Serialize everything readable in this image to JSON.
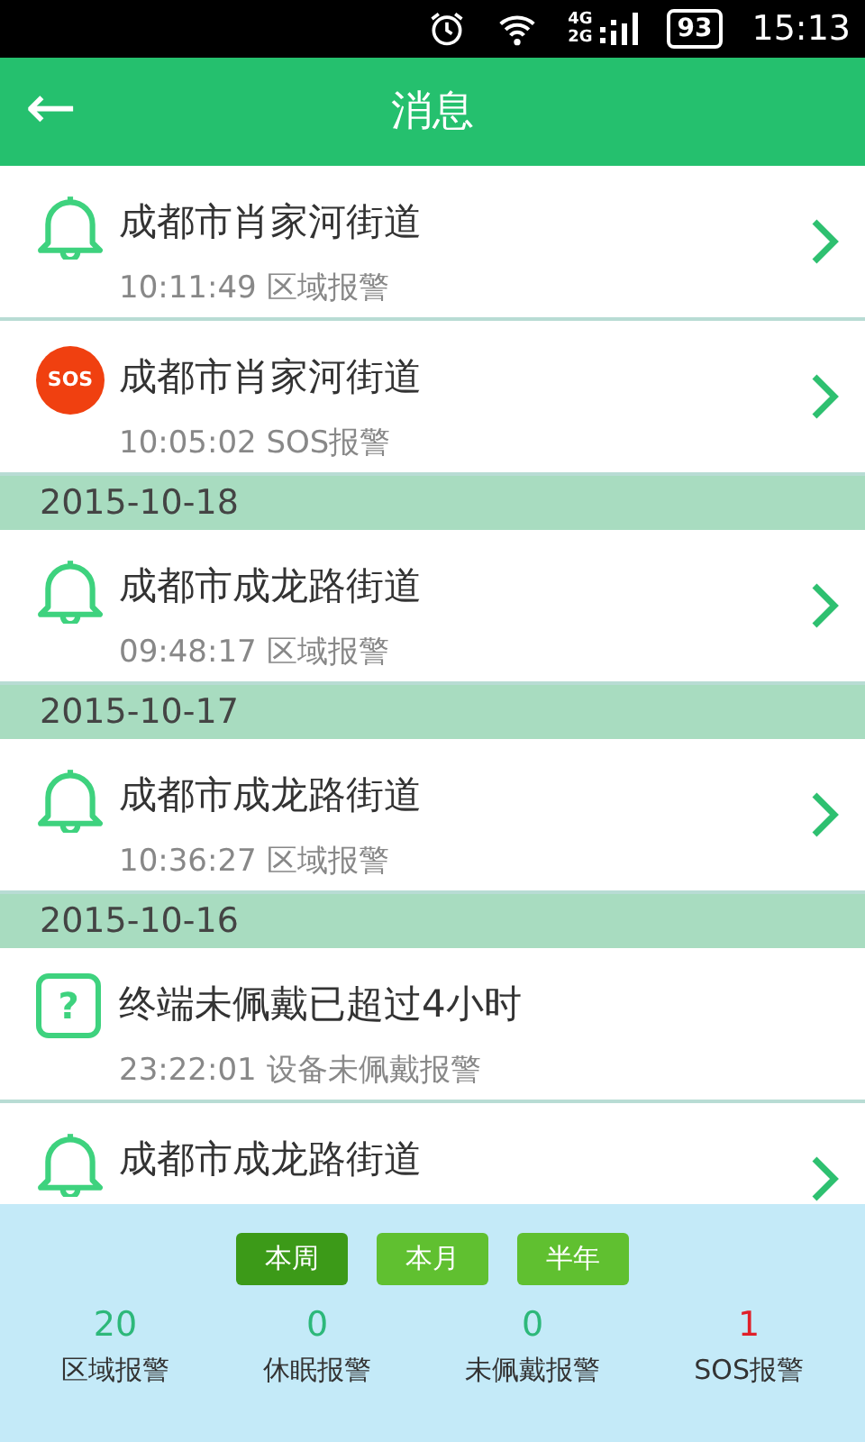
{
  "status_bar": {
    "network_top": "4G",
    "network_bottom": "2G",
    "battery": "93",
    "time": "15:13"
  },
  "header": {
    "back": "←",
    "title": "消息"
  },
  "messages": [
    {
      "kind": "area",
      "title": "成都市肖家河街道",
      "time": "10:11:49",
      "type": "区域报警",
      "has_arrow": true
    },
    {
      "kind": "sos",
      "icon_text": "SOS",
      "title": "成都市肖家河街道",
      "time": "10:05:02",
      "type": "SOS报警",
      "has_arrow": true
    },
    {
      "kind": "date",
      "label": "2015-10-18"
    },
    {
      "kind": "area",
      "title": "成都市成龙路街道",
      "time": "09:48:17",
      "type": "区域报警",
      "has_arrow": true
    },
    {
      "kind": "date",
      "label": "2015-10-17"
    },
    {
      "kind": "area",
      "title": "成都市成龙路街道",
      "time": "10:36:27",
      "type": "区域报警",
      "has_arrow": true
    },
    {
      "kind": "date",
      "label": "2015-10-16"
    },
    {
      "kind": "unworn",
      "icon_text": "?",
      "title": "终端未佩戴已超过4小时",
      "time": "23:22:01",
      "type": "设备未佩戴报警",
      "has_arrow": false
    },
    {
      "kind": "area",
      "title": "成都市成龙路街道",
      "has_arrow": true
    }
  ],
  "periods": [
    {
      "label": "本周",
      "selected": true
    },
    {
      "label": "本月",
      "selected": false
    },
    {
      "label": "半年",
      "selected": false
    }
  ],
  "stats": [
    {
      "value": "20",
      "label": "区域报警",
      "color": "#2db87a"
    },
    {
      "value": "0",
      "label": "休眠报警",
      "color": "#2db87a"
    },
    {
      "value": "0",
      "label": "未佩戴报警",
      "color": "#2db87a"
    },
    {
      "value": "1",
      "label": "SOS报警",
      "color": "#e0202a"
    }
  ]
}
